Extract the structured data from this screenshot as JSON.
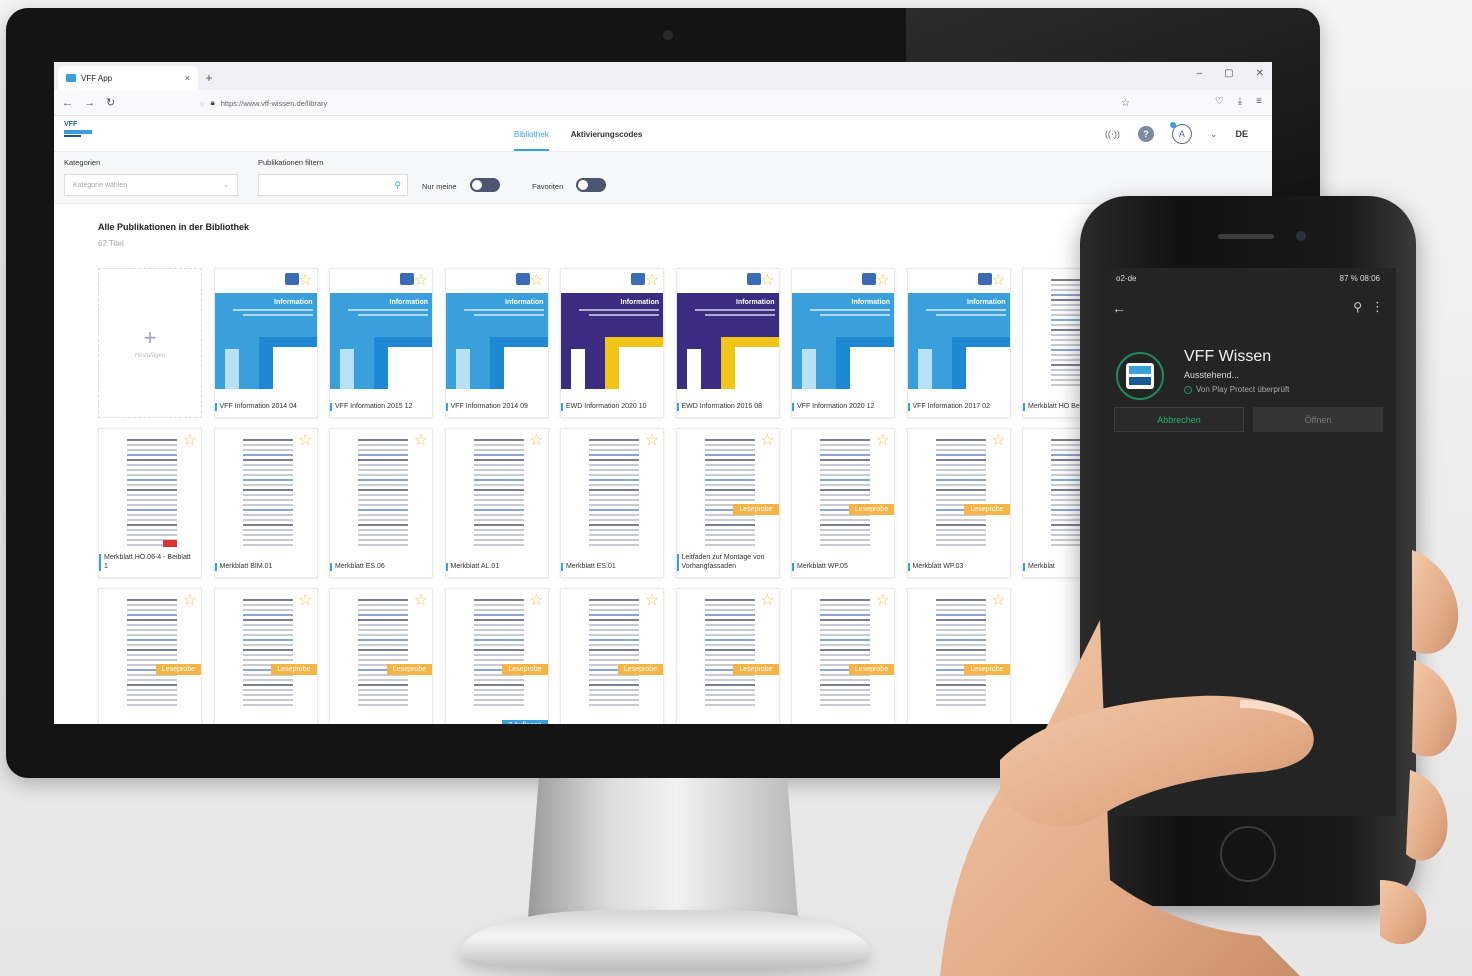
{
  "browser": {
    "tab_title": "VFF App",
    "tab_close": "×",
    "new_tab": "+",
    "url": "https://www.vff-wissen.de/library",
    "window_controls": [
      "–",
      "▢",
      "✕"
    ]
  },
  "app": {
    "nav": [
      {
        "label": "Bibliothek",
        "active": true
      },
      {
        "label": "Aktivierungscodes",
        "active": false
      }
    ],
    "help_label": "?",
    "user_initial": "A",
    "language": "DE"
  },
  "filters": {
    "category_label": "Kategorien",
    "category_placeholder": "Kategorie wählen",
    "search_label": "Publikationen filtern",
    "toggle_mine_label": "Nur meine",
    "toggle_fav_label": "Favoriten"
  },
  "library": {
    "title": "Alle Publikationen in der Bibliothek",
    "count": "62 Titel",
    "add_label": "Hinzufügen",
    "row1": [
      {
        "label": "VFF Information 2014 04",
        "band": "Information",
        "color": "#3aa0dc"
      },
      {
        "label": "VFF Information 2015 12",
        "band": "Information",
        "color": "#3aa0dc"
      },
      {
        "label": "VFF Information 2014 09",
        "band": "Information",
        "color": "#3aa0dc"
      },
      {
        "label": "EWD Information 2020 10",
        "band": "Information",
        "color": "#3b2c82"
      },
      {
        "label": "EWD Information 2016 08",
        "band": "Information",
        "color": "#3b2c82"
      },
      {
        "label": "VFF Information 2020 12",
        "band": "Information",
        "color": "#3aa0dc"
      },
      {
        "label": "VFF Information 2017 02",
        "band": "Information",
        "color": "#3aa0dc"
      },
      {
        "label": "Merkblatt HO Beiblatt 3",
        "band": "",
        "color": "#ffffff"
      }
    ],
    "row2": [
      {
        "label": "Merkblatt HO.06-4 - Beiblatt 1",
        "lese": false
      },
      {
        "label": "Merkblatt BIM.01",
        "lese": false
      },
      {
        "label": "Merkblatt ES.06",
        "lese": false
      },
      {
        "label": "Merkblatt AL.01",
        "lese": false
      },
      {
        "label": "Merkblatt ES.01",
        "lese": false
      },
      {
        "label": "Leitfaden zur Montage von Vorhangfassaden",
        "lese": true
      },
      {
        "label": "Merkblatt WP.05",
        "lese": true
      },
      {
        "label": "Merkblatt WP.03",
        "lese": true
      },
      {
        "label": "Merkblat",
        "lese": true
      }
    ],
    "row3_badges": [
      "Leseprobe",
      "Leseprobe",
      "Leseprobe",
      "Leseprobe",
      "Leseprobe",
      "Leseprobe",
      "Leseprobe",
      "Leseprobe"
    ],
    "leseprobe_label": "Leseprobe",
    "auflagen_label": "2 Auflagen"
  },
  "phone": {
    "carrier": "o2-de",
    "status_right": "87 %  08:06",
    "app_name": "VFF Wissen",
    "app_status": "Ausstehend...",
    "protect_text": "Von Play Protect überprüft",
    "cancel_label": "Abbrechen",
    "open_label": "Öffnen"
  }
}
